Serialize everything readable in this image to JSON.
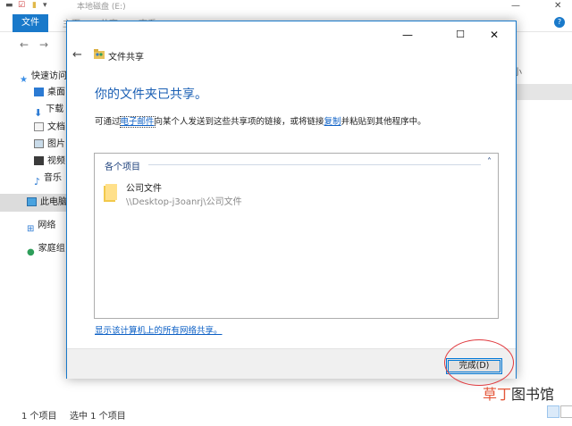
{
  "explorer": {
    "window_title": "本地磁盘 (E:)",
    "ribbon": {
      "file_tab": "文件",
      "tabs": [
        "主页",
        "共享",
        "查看"
      ]
    },
    "sidebar": {
      "items": [
        {
          "label": "快速访问",
          "icon": "star-icon"
        },
        {
          "label": "桌面",
          "icon": "desktop-icon"
        },
        {
          "label": "下载",
          "icon": "download-icon"
        },
        {
          "label": "文档",
          "icon": "document-icon"
        },
        {
          "label": "图片",
          "icon": "picture-icon"
        },
        {
          "label": "视频",
          "icon": "video-icon"
        },
        {
          "label": "音乐",
          "icon": "music-icon"
        },
        {
          "label": "此电脑",
          "icon": "computer-icon"
        },
        {
          "label": "网络",
          "icon": "network-icon"
        },
        {
          "label": "家庭组",
          "icon": "homegroup-icon"
        }
      ]
    },
    "right_label": "小",
    "status": {
      "count": "1 个项目",
      "selected": "选中 1 个项目"
    }
  },
  "dialog": {
    "title": "文件共享",
    "heading": "你的文件夹已共享。",
    "desc": {
      "part1": "可通过",
      "email_link": "电子邮件",
      "part2": "向某个人发送到这些共享项的链接，或将链接",
      "copy_link": "复制",
      "part3": "并粘贴到其他程序中。"
    },
    "group_header": "各个项目",
    "items": [
      {
        "name": "公司文件",
        "path": "\\\\Desktop-j3oanrj\\公司文件"
      }
    ],
    "network_link": "显示该计算机上的所有网络共享。",
    "finish_button": "完成(D)"
  },
  "watermark": {
    "part1": "草丁",
    "part2": "图书馆"
  },
  "colors": {
    "accent": "#1979ca",
    "link": "#0b5fc5",
    "circle": "#e0393e"
  }
}
